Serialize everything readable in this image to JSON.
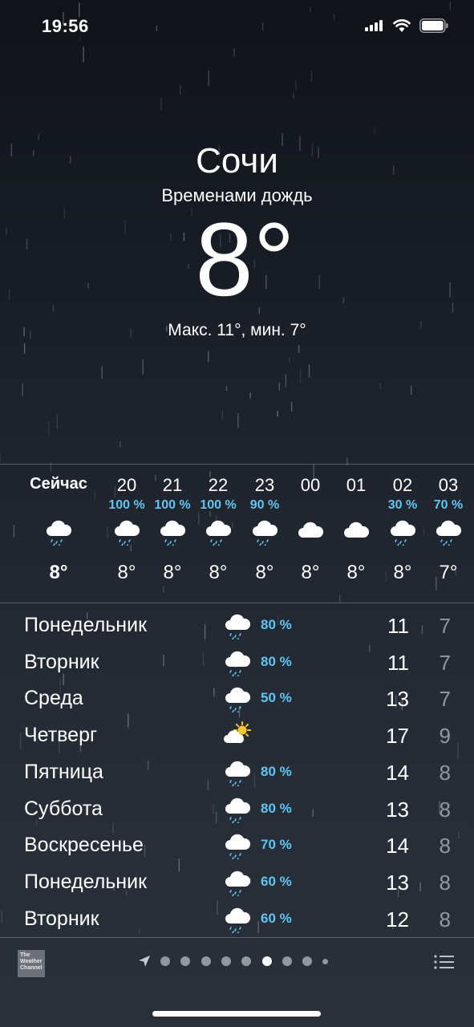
{
  "status_bar": {
    "time": "19:56"
  },
  "location": {
    "city": "Сочи",
    "condition": "Временами дождь",
    "temperature": "8°",
    "hilo": "Макс. 11°, мин. 7°"
  },
  "hourly": [
    {
      "label": "Сейчас",
      "prob": "",
      "icon": "rain-cloud-icon",
      "temp": "8°"
    },
    {
      "label": "20",
      "prob": "100 %",
      "icon": "rain-cloud-icon",
      "temp": "8°"
    },
    {
      "label": "21",
      "prob": "100 %",
      "icon": "rain-cloud-icon",
      "temp": "8°"
    },
    {
      "label": "22",
      "prob": "100 %",
      "icon": "rain-cloud-icon",
      "temp": "8°"
    },
    {
      "label": "23",
      "prob": "90 %",
      "icon": "rain-cloud-icon",
      "temp": "8°"
    },
    {
      "label": "00",
      "prob": "",
      "icon": "cloud-icon",
      "temp": "8°"
    },
    {
      "label": "01",
      "prob": "",
      "icon": "cloud-icon",
      "temp": "8°"
    },
    {
      "label": "02",
      "prob": "30 %",
      "icon": "rain-cloud-icon",
      "temp": "8°"
    },
    {
      "label": "03",
      "prob": "70 %",
      "icon": "rain-cloud-icon",
      "temp": "7°"
    }
  ],
  "daily": [
    {
      "day": "Понедельник",
      "icon": "rain-cloud-icon",
      "prob": "80 %",
      "hi": "11",
      "lo": "7"
    },
    {
      "day": "Вторник",
      "icon": "rain-cloud-icon",
      "prob": "80 %",
      "hi": "11",
      "lo": "7"
    },
    {
      "day": "Среда",
      "icon": "rain-cloud-icon",
      "prob": "50 %",
      "hi": "13",
      "lo": "7"
    },
    {
      "day": "Четверг",
      "icon": "partly-sunny-icon",
      "prob": "",
      "hi": "17",
      "lo": "9"
    },
    {
      "day": "Пятница",
      "icon": "rain-cloud-icon",
      "prob": "80 %",
      "hi": "14",
      "lo": "8"
    },
    {
      "day": "Суббота",
      "icon": "rain-cloud-icon",
      "prob": "80 %",
      "hi": "13",
      "lo": "8"
    },
    {
      "day": "Воскресенье",
      "icon": "rain-cloud-icon",
      "prob": "70 %",
      "hi": "14",
      "lo": "8"
    },
    {
      "day": "Понедельник",
      "icon": "rain-cloud-icon",
      "prob": "60 %",
      "hi": "13",
      "lo": "8"
    },
    {
      "day": "Вторник",
      "icon": "rain-cloud-icon",
      "prob": "60 %",
      "hi": "12",
      "lo": "8"
    }
  ],
  "bottom_bar": {
    "logo_text": "The Weather Channel",
    "page_count": 9,
    "active_page": 6
  },
  "colors": {
    "precipitation": "#5ec6f4",
    "background_top": "#101319",
    "background_bottom": "#2a303a"
  }
}
